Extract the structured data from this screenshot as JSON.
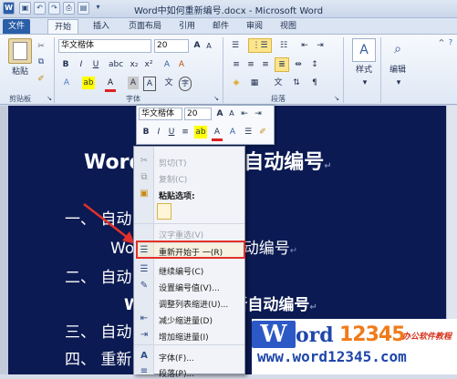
{
  "window": {
    "title": "Word中如何重新编号.docx - Microsoft Word"
  },
  "tabs": [
    "文件",
    "开始",
    "插入",
    "页面布局",
    "引用",
    "邮件",
    "审阅",
    "视图"
  ],
  "ribbon": {
    "clipboard": {
      "paste": "粘贴",
      "group": "剪贴板"
    },
    "font": {
      "name": "华文楷体",
      "size": "20",
      "group": "字体"
    },
    "paragraph": {
      "group": "段落"
    },
    "styles": {
      "label": "样式"
    },
    "editing": {
      "label": "编辑"
    }
  },
  "mini_toolbar": {
    "font": "华文楷体",
    "size": "20"
  },
  "document": {
    "heading": "Word中如何重新自动编号",
    "lines": [
      {
        "num": "一、",
        "text": "自动"
      },
      {
        "num": "",
        "text": "Word中如何重新自动编号"
      },
      {
        "num": "二、",
        "text": "自动"
      },
      {
        "num": "",
        "text": "Word中如何重新自动编号"
      },
      {
        "num": "三、",
        "text": "自动"
      },
      {
        "num": "四、",
        "text": "重新"
      }
    ]
  },
  "context_menu": {
    "items": [
      {
        "label": "剪切(T)",
        "disabled": true
      },
      {
        "label": "复制(C)",
        "disabled": true
      },
      {
        "label": "粘贴选项:",
        "disabled": false
      },
      {
        "label": "汉字重选(V)",
        "disabled": true
      },
      {
        "label": "重新开始于 一(R)",
        "disabled": false
      },
      {
        "label": "继续编号(C)",
        "disabled": false
      },
      {
        "label": "设置编号值(V)...",
        "disabled": false
      },
      {
        "label": "调整列表缩进(U)...",
        "disabled": false
      },
      {
        "label": "减少缩进量(D)",
        "disabled": false
      },
      {
        "label": "增加缩进量(I)",
        "disabled": false
      },
      {
        "label": "字体(F)...",
        "disabled": false
      },
      {
        "label": "段落(P)...",
        "disabled": false
      }
    ]
  },
  "watermark": {
    "brand_w": "W",
    "brand_rest": "ord",
    "brand_num": "12345",
    "tagline": "办公软件教程",
    "url": "www.word12345.com"
  },
  "colors": {
    "page_bg": "#0b1a52",
    "highlight": "#e2302b",
    "file_tab": "#2a5ea8"
  }
}
